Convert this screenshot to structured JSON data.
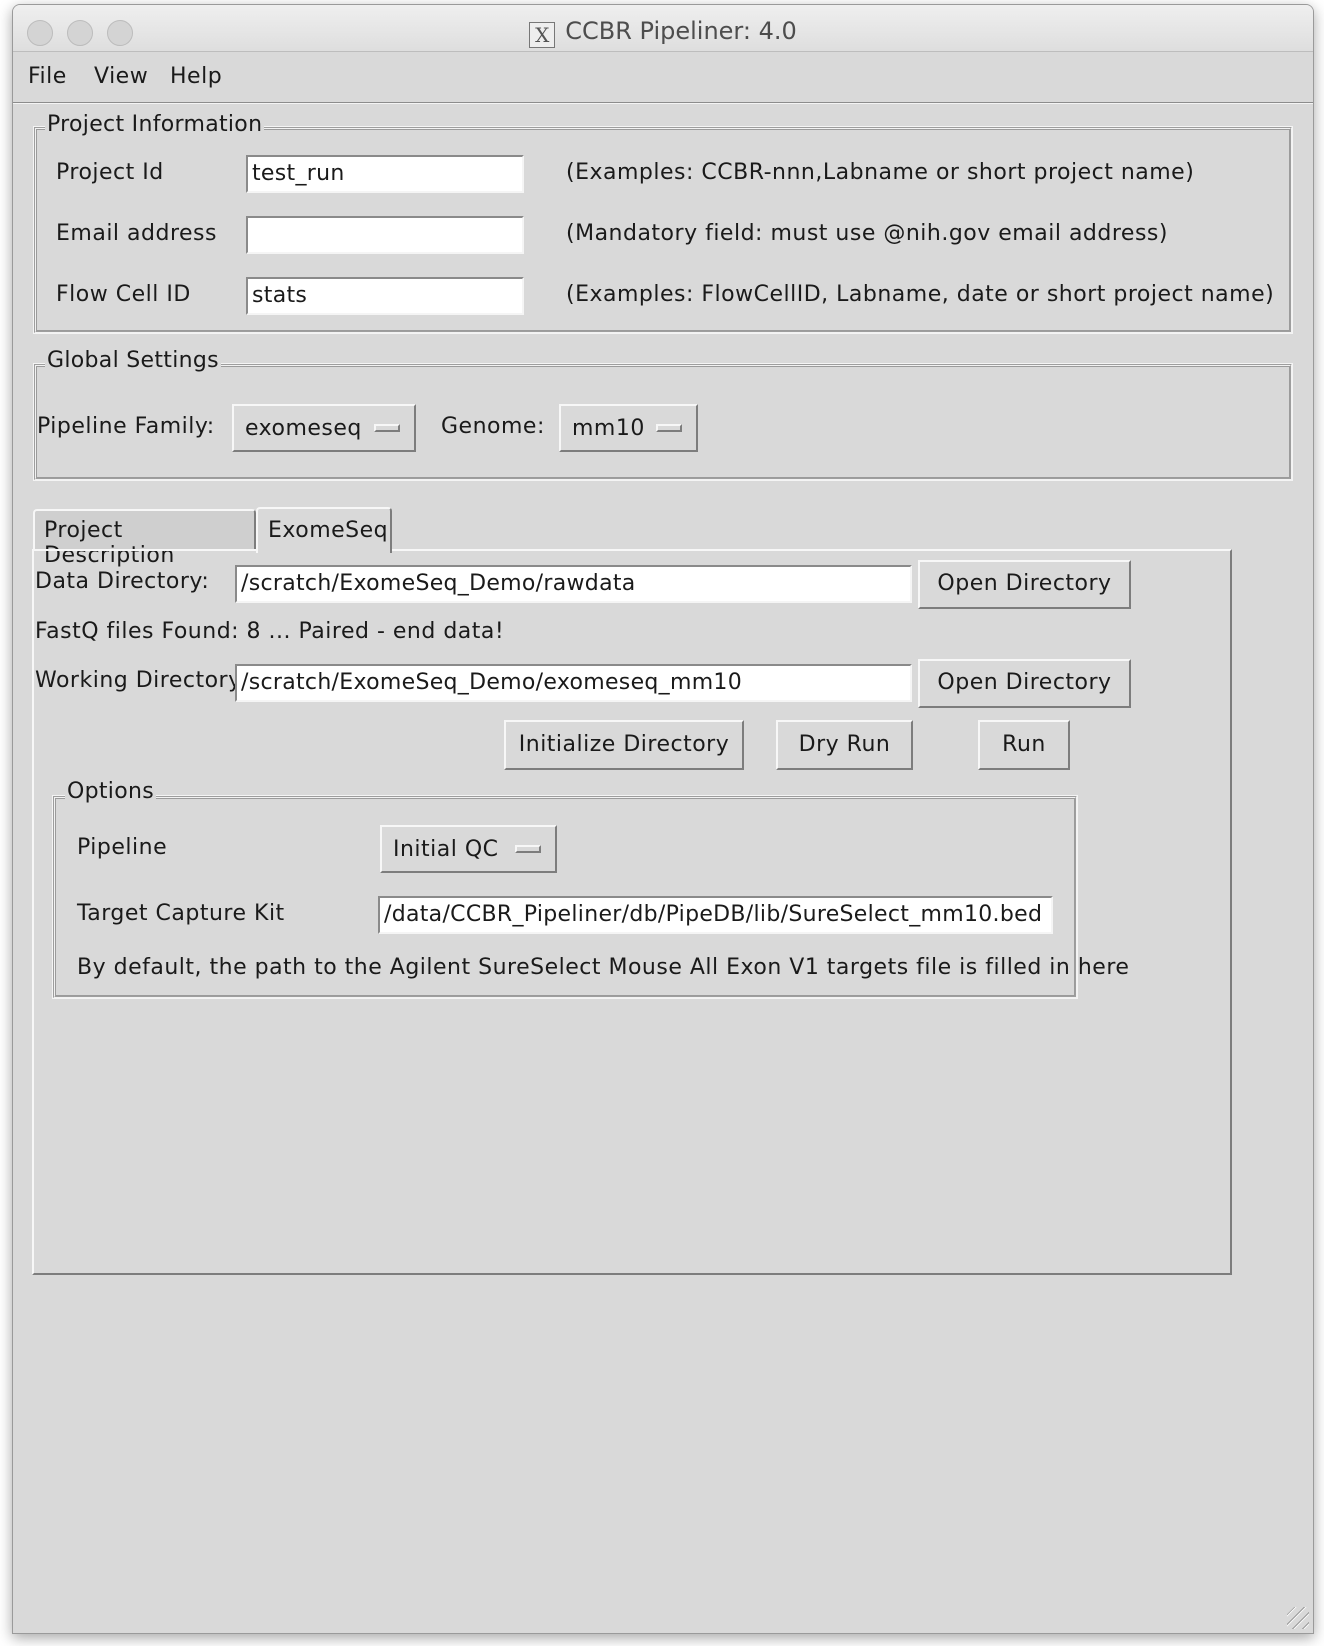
{
  "window": {
    "title": "CCBR Pipeliner: 4.0"
  },
  "menu": [
    "File",
    "View",
    "Help"
  ],
  "project_info": {
    "legend": "Project Information",
    "rows": [
      {
        "label": "Project Id",
        "value": "test_run",
        "hint": "(Examples: CCBR-nnn,Labname or short project name)"
      },
      {
        "label": "Email address",
        "value": "",
        "hint": "(Mandatory field: must use @nih.gov email address)"
      },
      {
        "label": "Flow Cell ID",
        "value": "stats",
        "hint": "(Examples: FlowCellID, Labname, date or short project name)"
      }
    ]
  },
  "global_settings": {
    "legend": "Global Settings",
    "pipeline_family_label": "Pipeline Family:",
    "pipeline_family_value": "exomeseq",
    "genome_label": "Genome:",
    "genome_value": "mm10"
  },
  "tabs": [
    "Project Description",
    "ExomeSeq"
  ],
  "exomeseq": {
    "data_dir_label": "Data Directory:",
    "data_dir_value": "/scratch/ExomeSeq_Demo/rawdata",
    "open_dir_label": "Open Directory",
    "fastq_found": "FastQ files Found:  8 ... Paired - end data!",
    "work_dir_label": "Working Directory:",
    "work_dir_value": "/scratch/ExomeSeq_Demo/exomeseq_mm10",
    "init_label": "Initialize Directory",
    "dry_run_label": "Dry Run",
    "run_label": "Run",
    "options": {
      "legend": "Options",
      "pipeline_label": "Pipeline",
      "pipeline_value": "Initial QC",
      "target_label": "Target Capture Kit",
      "target_value": "/data/CCBR_Pipeliner/db/PipeDB/lib/SureSelect_mm10.bed",
      "note": "By default, the path to the Agilent SureSelect Mouse All Exon V1 targets file is filled in here"
    }
  }
}
